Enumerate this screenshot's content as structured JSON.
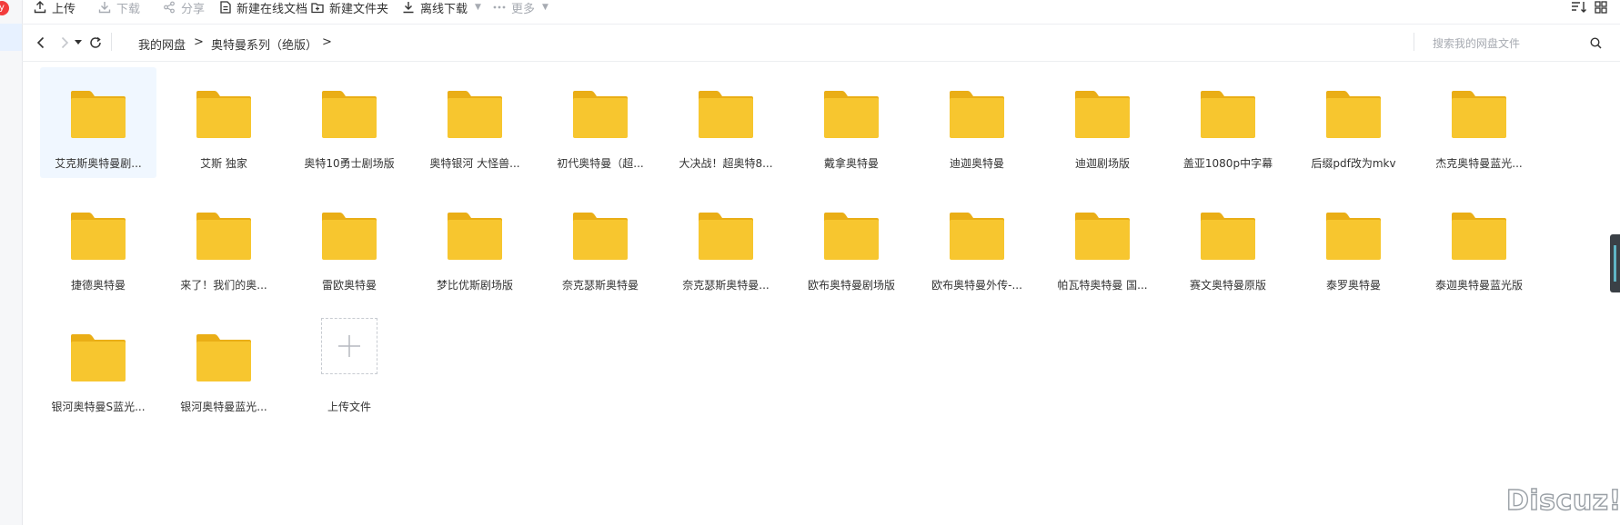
{
  "badge_text": "y",
  "toolbar": {
    "upload": "上传",
    "download": "下载",
    "share": "分享",
    "new_doc": "新建在线文档",
    "new_folder": "新建文件夹",
    "offline_download": "离线下载",
    "more": "更多"
  },
  "breadcrumb": {
    "root": "我的网盘",
    "sep1": ">",
    "current": "奥特曼系列（绝版）",
    "sep2": ">"
  },
  "search": {
    "placeholder": "搜索我的网盘文件"
  },
  "folders": [
    "艾克斯奥特曼剧...",
    "艾斯 独家",
    "奥特10勇士剧场版",
    "奥特银河 大怪兽...",
    "初代奥特曼（超...",
    "大决战！超奥特8...",
    "戴拿奥特曼",
    "迪迦奥特曼",
    "迪迦剧场版",
    "盖亚1080p中字幕",
    "后缀pdf改为mkv",
    "杰克奥特曼蓝光...",
    "捷德奥特曼",
    "来了！我们的奥...",
    "雷欧奥特曼",
    "梦比优斯剧场版",
    "奈克瑟斯奥特曼",
    "奈克瑟斯奥特曼...",
    "欧布奥特曼剧场版",
    "欧布奥特曼外传-...",
    "帕瓦特奥特曼 国...",
    "赛文奥特曼原版",
    "泰罗奥特曼",
    "泰迦奥特曼蓝光版",
    "银河奥特曼S蓝光...",
    "银河奥特曼蓝光..."
  ],
  "upload_tile": {
    "label": "上传文件"
  },
  "watermark": "Discuz!",
  "colors": {
    "folder": "#f7c62f",
    "folder_tab": "#eaae16",
    "selected_bg": "#f0f7ff"
  }
}
